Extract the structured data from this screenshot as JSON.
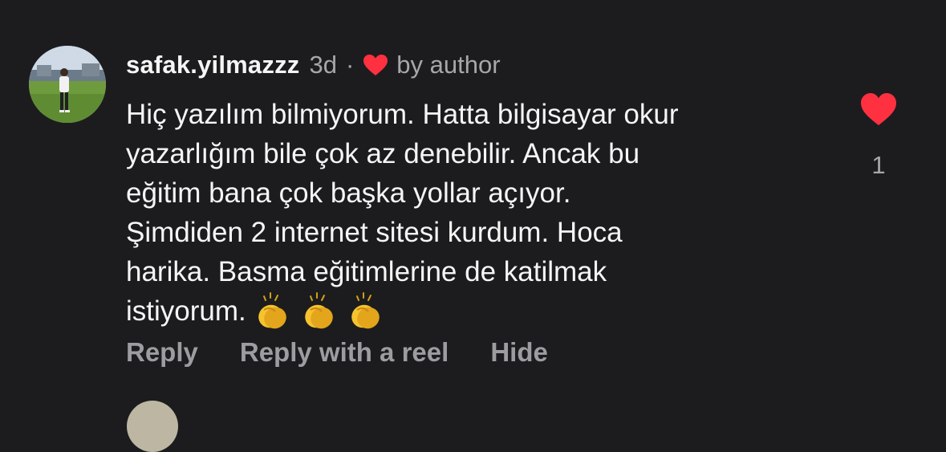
{
  "comment": {
    "username": "safak.yilmazzz",
    "time": "3d",
    "separator": "·",
    "by_author_label": "by author",
    "text": "Hiç yazılım bilmiyorum. Hatta bilgisayar okur\nyazarlığım bile çok az denebilir. Ancak bu\neğitim bana çok başka yollar açıyor.\nŞimdiden 2 internet sitesi kurdum. Hoca\nharika. Basma eğitimlerine de katilmak\nistiyorum.",
    "emoji": [
      "clapping-hands-icon",
      "clapping-hands-icon",
      "clapping-hands-icon"
    ],
    "like_count": "1",
    "liked": true
  },
  "actions": {
    "reply": "Reply",
    "reply_with_reel": "Reply with a reel",
    "hide": "Hide"
  },
  "colors": {
    "background": "#1c1c1e",
    "text_primary": "#f5f5f5",
    "text_secondary": "#a7a7ab",
    "action_text": "#9c9ca1",
    "heart": "#ff3040"
  }
}
